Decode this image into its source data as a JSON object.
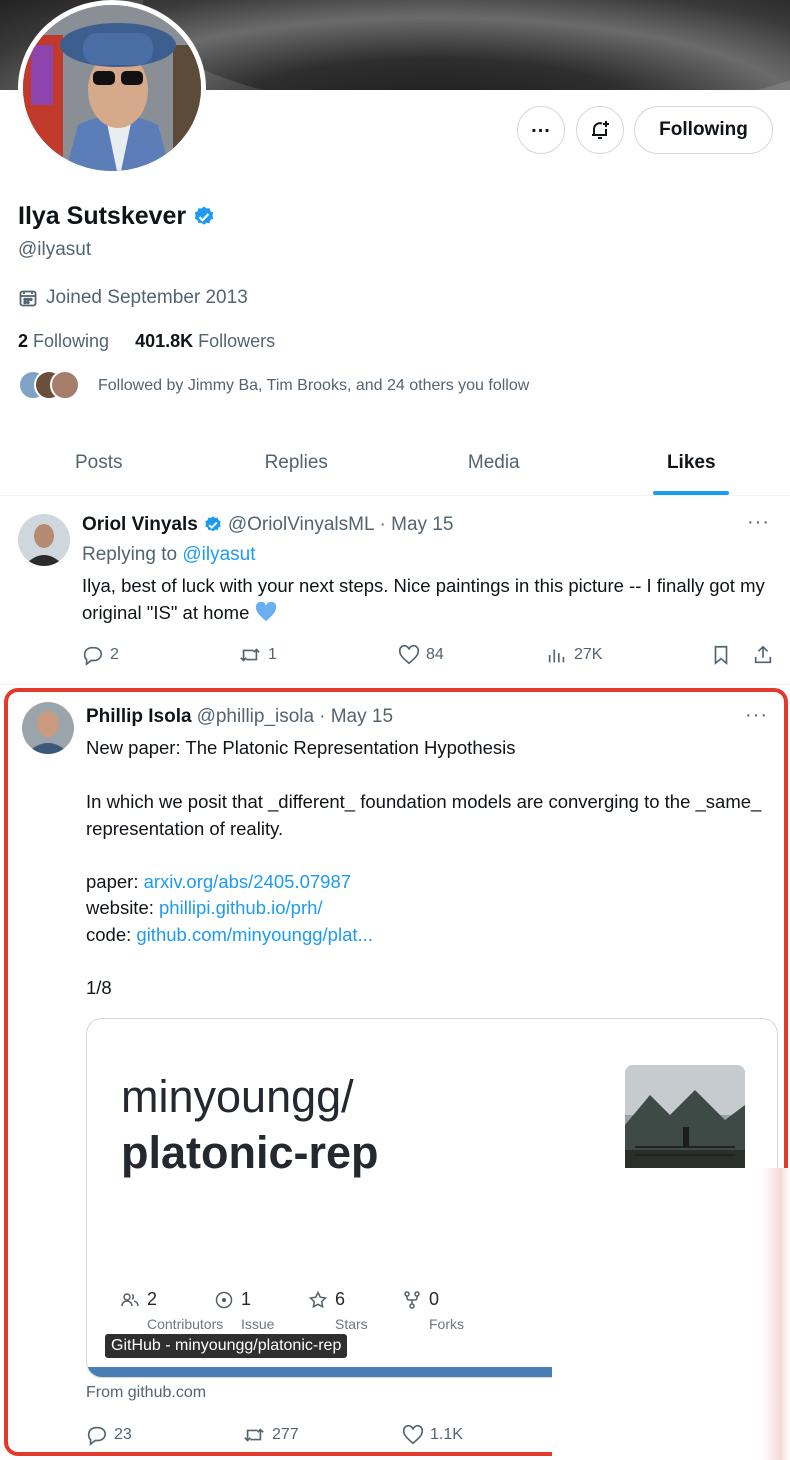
{
  "profile": {
    "name": "Ilya Sutskever",
    "handle": "@ilyasut",
    "joined": "Joined September 2013",
    "following_count": "2",
    "following_label": "Following",
    "followers_count": "401.8K",
    "followers_label": "Followers",
    "followed_by": "Followed by Jimmy Ba, Tim Brooks, and 24 others you follow",
    "follow_button": "Following"
  },
  "tabs": [
    "Posts",
    "Replies",
    "Media",
    "Likes"
  ],
  "active_tab": "Likes",
  "tweets": [
    {
      "author": "Oriol Vinyals",
      "handle": "@OriolVinyalsML",
      "date": "· May 15",
      "reply_prefix": "Replying to ",
      "reply_handle": "@ilyasut",
      "text": "Ilya, best of luck with your next steps. Nice paintings in this picture -- I finally got my original \"IS\" at home",
      "replies": "2",
      "reposts": "1",
      "likes": "84",
      "views": "27K"
    },
    {
      "author": "Phillip Isola",
      "handle": "@phillip_isola",
      "date": "· May 15",
      "line1": "New paper: The Platonic Representation Hypothesis",
      "line2": "In which we posit that _different_ foundation models are converging to the _same_ representation of reality.",
      "paper_label": "paper: ",
      "paper_link": "arxiv.org/abs/2405.07987",
      "website_label": "website: ",
      "website_link": "phillipi.github.io/prh/",
      "code_label": "code: ",
      "code_link": "github.com/minyoungg/plat...",
      "thread": "1/8",
      "card": {
        "owner": "minyoungg/",
        "repo": "platonic-rep",
        "contributors_count": "2",
        "contributors_label": "Contributors",
        "issue_count": "1",
        "issue_label": "Issue",
        "stars_count": "6",
        "stars_label": "Stars",
        "forks_count": "0",
        "forks_label": "Forks",
        "tooltip": "GitHub - minyoungg/platonic-rep"
      },
      "from": "From github.com",
      "replies": "23",
      "reposts": "277",
      "likes": "1.1K"
    }
  ],
  "colors": {
    "accent": "#1d9bf0",
    "highlight_border": "#e3382a",
    "text_secondary": "#536471"
  }
}
